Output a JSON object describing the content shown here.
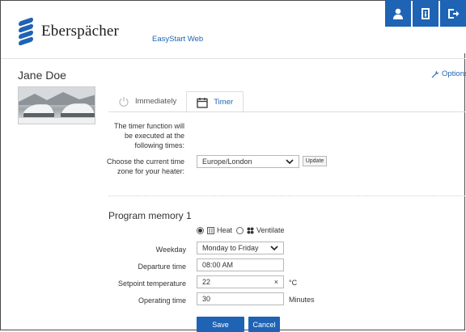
{
  "brand": {
    "logo_text": "Eberspächer",
    "app_name": "EasyStart Web",
    "color": "#1e63b4"
  },
  "header": {
    "buttons": [
      "user-icon",
      "manual-icon",
      "logout-icon"
    ]
  },
  "user": {
    "name": "Jane Doe"
  },
  "options": {
    "label": "Options"
  },
  "tabs": [
    {
      "label": "Immediately",
      "icon": "power-icon",
      "active": false
    },
    {
      "label": "Timer",
      "icon": "calendar-icon",
      "active": true
    }
  ],
  "timer": {
    "intro_line1": "The timer function will",
    "intro_line2": "be executed at the",
    "intro_line3": "following times:",
    "tz_label_line1": "Choose the current time",
    "tz_label_line2": "zone for your heater:",
    "tz_value": "Europe/London",
    "update_label": "Update"
  },
  "program": {
    "title": "Program memory 1",
    "mode_heat": "Heat",
    "mode_ventilate": "Ventilate",
    "selected_mode": "Heat",
    "weekday_label": "Weekday",
    "weekday_value": "Monday to Friday",
    "departure_label": "Departure time",
    "departure_value": "08:00 AM",
    "setpoint_label": "Setpoint temperature",
    "setpoint_value": "22",
    "setpoint_clear": "×",
    "setpoint_unit": "°C",
    "operating_label": "Operating time",
    "operating_value": "30",
    "operating_unit": "Minutes",
    "save_label": "Save",
    "cancel_label": "Cancel"
  }
}
